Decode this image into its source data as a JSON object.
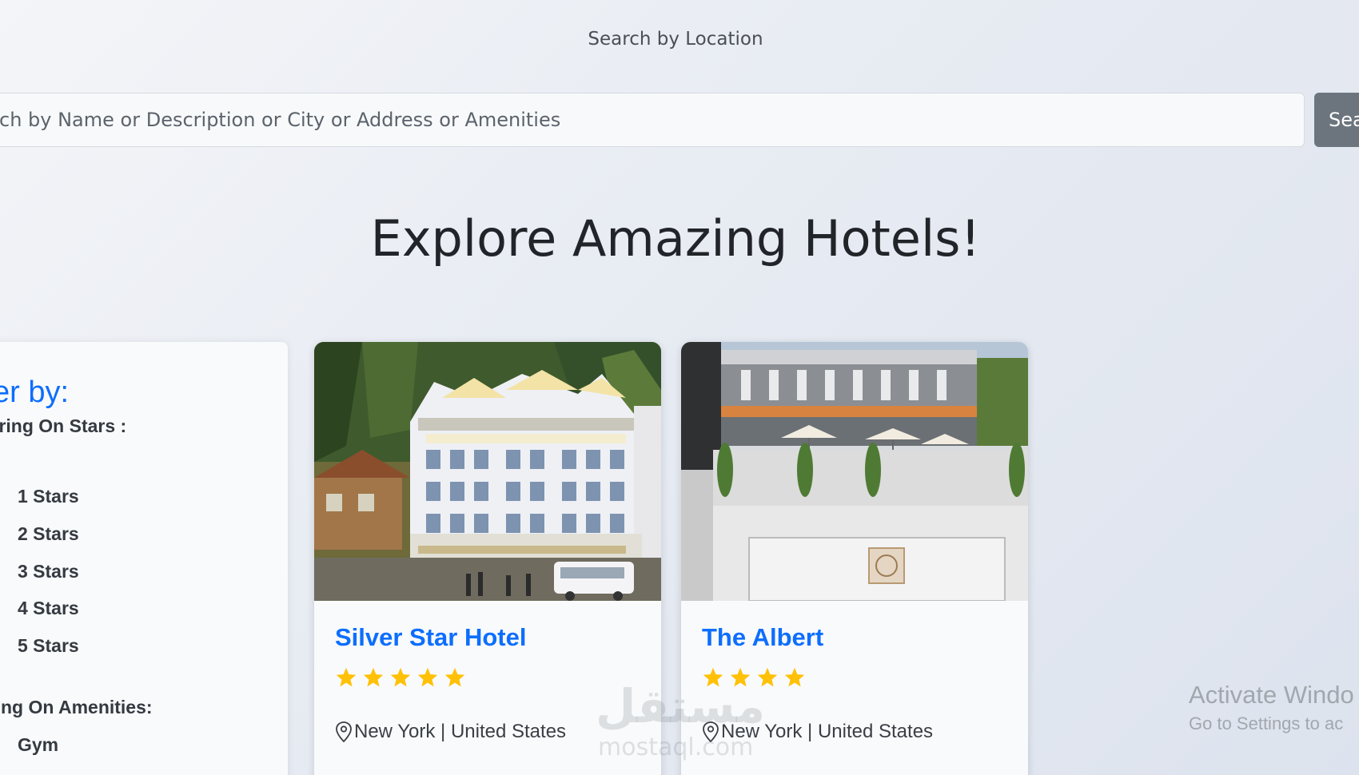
{
  "search": {
    "caption": "Search by Location",
    "placeholder": "ch by Name or Description or City or Address or Amenities",
    "button_label": "Sea"
  },
  "heading": "Explore Amazing Hotels!",
  "filters": {
    "title": "lter by:",
    "stars_group_title": "tering On Stars :",
    "star_options": [
      "1 Stars",
      "2 Stars",
      "3 Stars",
      "4 Stars",
      "5 Stars"
    ],
    "amenities_group_title": "tring On Amenities:",
    "amenity_options": [
      "Gym"
    ]
  },
  "hotels": [
    {
      "name": "Silver Star Hotel",
      "stars": 5,
      "location": "New York | United States",
      "star_icon": "star-icon",
      "location_icon": "map-pin-icon"
    },
    {
      "name": "The Albert",
      "stars": 4,
      "location": "New York | United States",
      "star_icon": "star-icon",
      "location_icon": "map-pin-icon"
    }
  ],
  "overlay": {
    "activate_windows": "Activate Windo",
    "go_to_settings": "Go to Settings to ac",
    "logo_text": "مستقل",
    "logo_subtext": "mostaql.com"
  },
  "colors": {
    "accent_blue": "#0d6efd",
    "search_button": "#6c757d",
    "star_yellow": "#ffc107",
    "book_button": "#1e4d2b"
  }
}
